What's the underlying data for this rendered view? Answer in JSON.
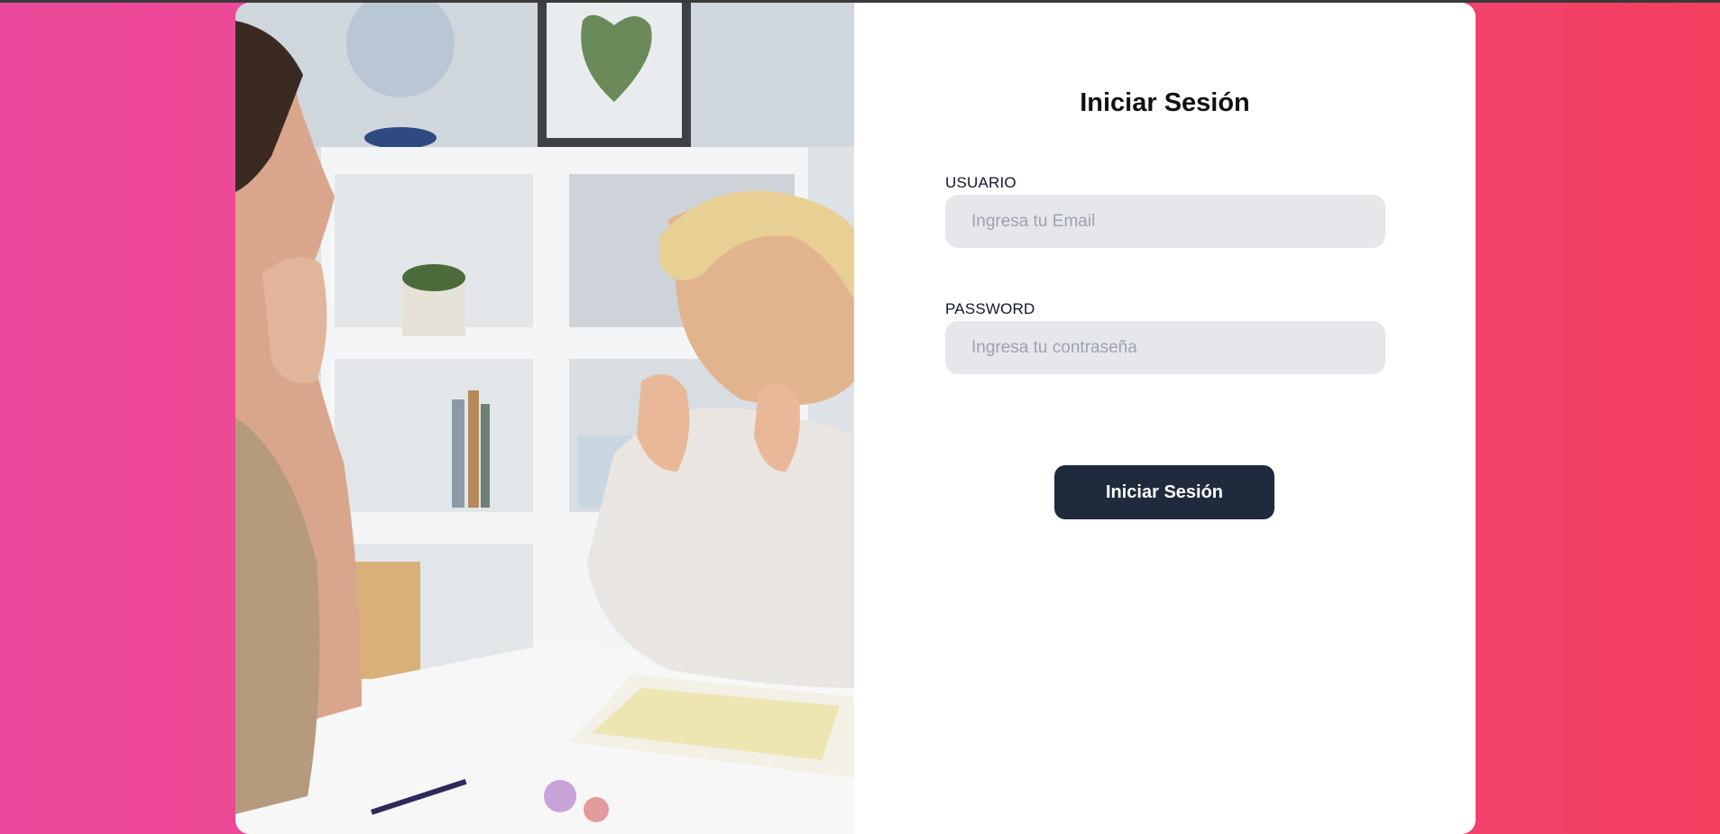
{
  "login": {
    "title": "Iniciar Sesión",
    "username": {
      "label": "USUARIO",
      "placeholder": "Ingresa tu Email",
      "value": ""
    },
    "password": {
      "label": "PASSWORD",
      "placeholder": "Ingresa tu contraseña",
      "value": ""
    },
    "submit_label": "Iniciar Sesión"
  },
  "colors": {
    "background_left": "#ec4899",
    "background_right": "#f43f5e",
    "card": "#ffffff",
    "input_bg": "#e5e7eb",
    "button_bg": "#1f2a3c",
    "button_text": "#ffffff"
  },
  "image": {
    "semantic": "teacher-and-child-smiling-photo"
  }
}
